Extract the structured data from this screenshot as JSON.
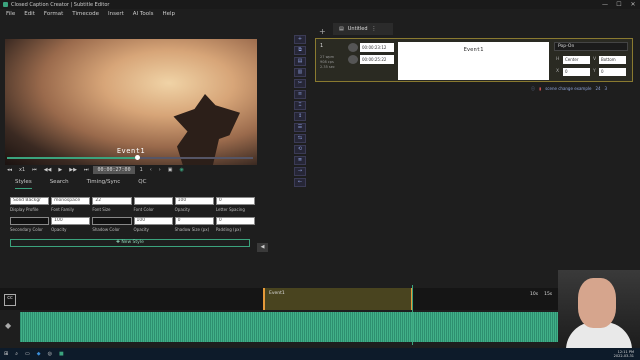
{
  "window": {
    "title": "Closed Caption Creator | Subtitle Editor",
    "controls": [
      "—",
      "☐",
      "✕"
    ]
  },
  "menu": [
    "File",
    "Edit",
    "Format",
    "Timecode",
    "Insert",
    "AI Tools",
    "Help"
  ],
  "video": {
    "subtitle": "Event1",
    "progress": 0.52
  },
  "transport": {
    "speed": "x1",
    "timecode": "00:00:27:00",
    "frame": "1"
  },
  "tabs": [
    "Styles",
    "Search",
    "Timing/Sync",
    "QC"
  ],
  "styles": {
    "row1_values": [
      "Solid Backgr",
      "monospace",
      "22",
      "",
      "100",
      "0"
    ],
    "row1_labels": [
      "Display Profile",
      "Font Family",
      "Font Size",
      "Font Color",
      "Opacity",
      "Letter Spacing"
    ],
    "row2_values": [
      "",
      "100",
      "",
      "100",
      "0",
      "0"
    ],
    "row2_labels": [
      "Secondary Color",
      "Opacity",
      "Shadow Color",
      "Opacity",
      "Shadow Size (px)",
      "Padding (px)"
    ],
    "new_style": "New Style"
  },
  "doc": {
    "tab": "Untitled",
    "menu": "⋮"
  },
  "event": {
    "number": "1",
    "stats": [
      "27 wpm",
      "908 cps",
      "2.35 sec"
    ],
    "start": "00:00:23:12",
    "end": "00:00:25:22",
    "text": "Event1",
    "mode": "Pop-On",
    "h_label": "H",
    "h_value": "Center",
    "v_label": "V",
    "v_value": "Bottom",
    "x_label": "X",
    "x_value": "0",
    "y_label": "Y",
    "y_value": "0"
  },
  "footer": {
    "link": "scene change example",
    "count_a": "24",
    "count_b": "3"
  },
  "timeline": {
    "label": "Event1",
    "zoom_a": "10s",
    "zoom_b": "15s"
  },
  "taskbar": {
    "time": "12:11 PM",
    "date": "2022-03-31"
  }
}
